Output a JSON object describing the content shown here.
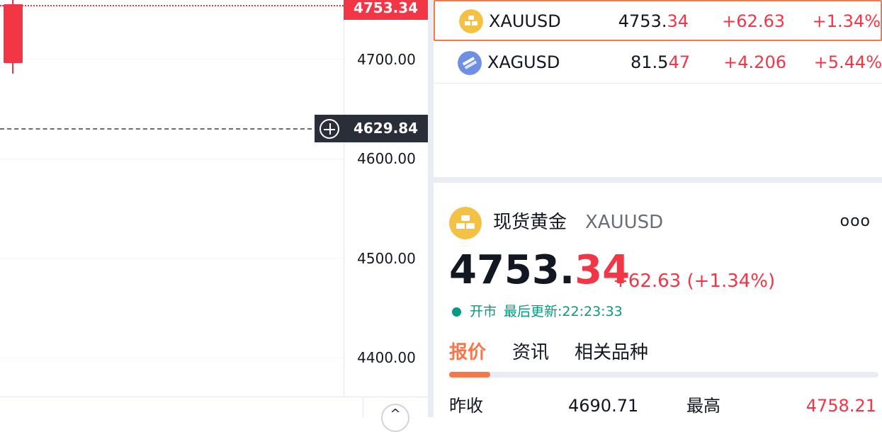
{
  "chart": {
    "price_scale_labels": [
      "4700.00",
      "4600.00",
      "4500.00",
      "4400.00"
    ],
    "last_price": "4753.34",
    "crosshair_price": "4629.84",
    "scroll_up_glyph": "^",
    "colors": {
      "down": "#f23645",
      "crosshair": "#2a2e39"
    }
  },
  "watchlist": {
    "rows": [
      {
        "symbol": "XAUUSD",
        "last_main": "4753.",
        "last_hl": "34",
        "change": "+62.63",
        "change_pct": "+1.34%",
        "icon": "gold-bar-icon",
        "selected": true
      },
      {
        "symbol": "XAGUSD",
        "last_main": "81.5",
        "last_hl": "47",
        "change": "+4.206",
        "change_pct": "+5.44%",
        "icon": "silver-bar-icon",
        "selected": false
      }
    ]
  },
  "details": {
    "name": "现货黄金",
    "symbol": "XAUUSD",
    "more": "ooo",
    "price_main": "4753.",
    "price_hl": "34",
    "change": "+62.63",
    "change_pct": "(+1.34%)",
    "status": "开市",
    "last_update_label": "最后更新:",
    "last_update_time": "22:23:33",
    "tabs": [
      "报价",
      "资讯",
      "相关品种"
    ],
    "active_tab": 0,
    "quotes": {
      "prev_close_label": "昨收",
      "prev_close": "4690.71",
      "high_label": "最高",
      "high": "4758.21"
    },
    "colors": {
      "up": "#f23645",
      "accent": "#f7764a",
      "open_status": "#089981"
    }
  }
}
